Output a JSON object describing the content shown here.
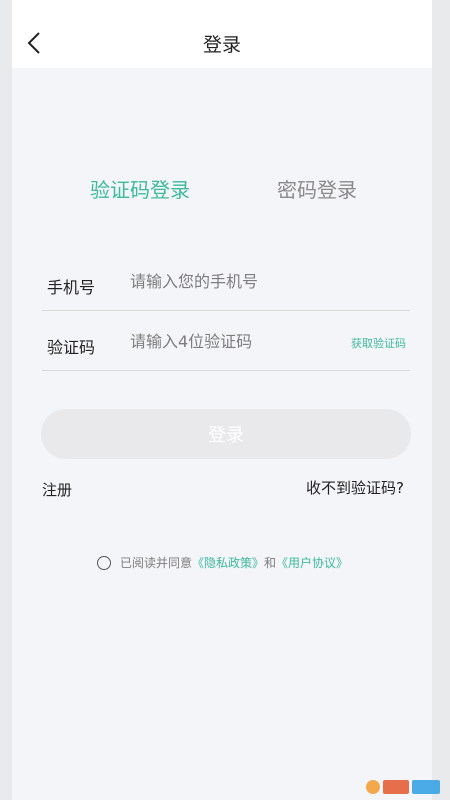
{
  "header": {
    "title": "登录",
    "back_icon": "chevron-left-icon"
  },
  "tabs": [
    {
      "label": "验证码登录",
      "active": true
    },
    {
      "label": "密码登录",
      "active": false
    }
  ],
  "form": {
    "phone": {
      "label": "手机号",
      "placeholder": "请输入您的手机号",
      "value": ""
    },
    "code": {
      "label": "验证码",
      "placeholder": "请输入4位验证码",
      "value": "",
      "get_code_label": "获取验证码"
    }
  },
  "login_button": "登录",
  "links": {
    "register": "注册",
    "no_code": "收不到验证码?"
  },
  "agreement": {
    "prefix": "已阅读并同意",
    "privacy": "《隐私政策》",
    "and": "和",
    "terms": "《用户协议》",
    "checked": false
  },
  "colors": {
    "accent": "#3dba9c",
    "button_disabled": "#e9e9eb",
    "background": "#f4f5f8"
  }
}
